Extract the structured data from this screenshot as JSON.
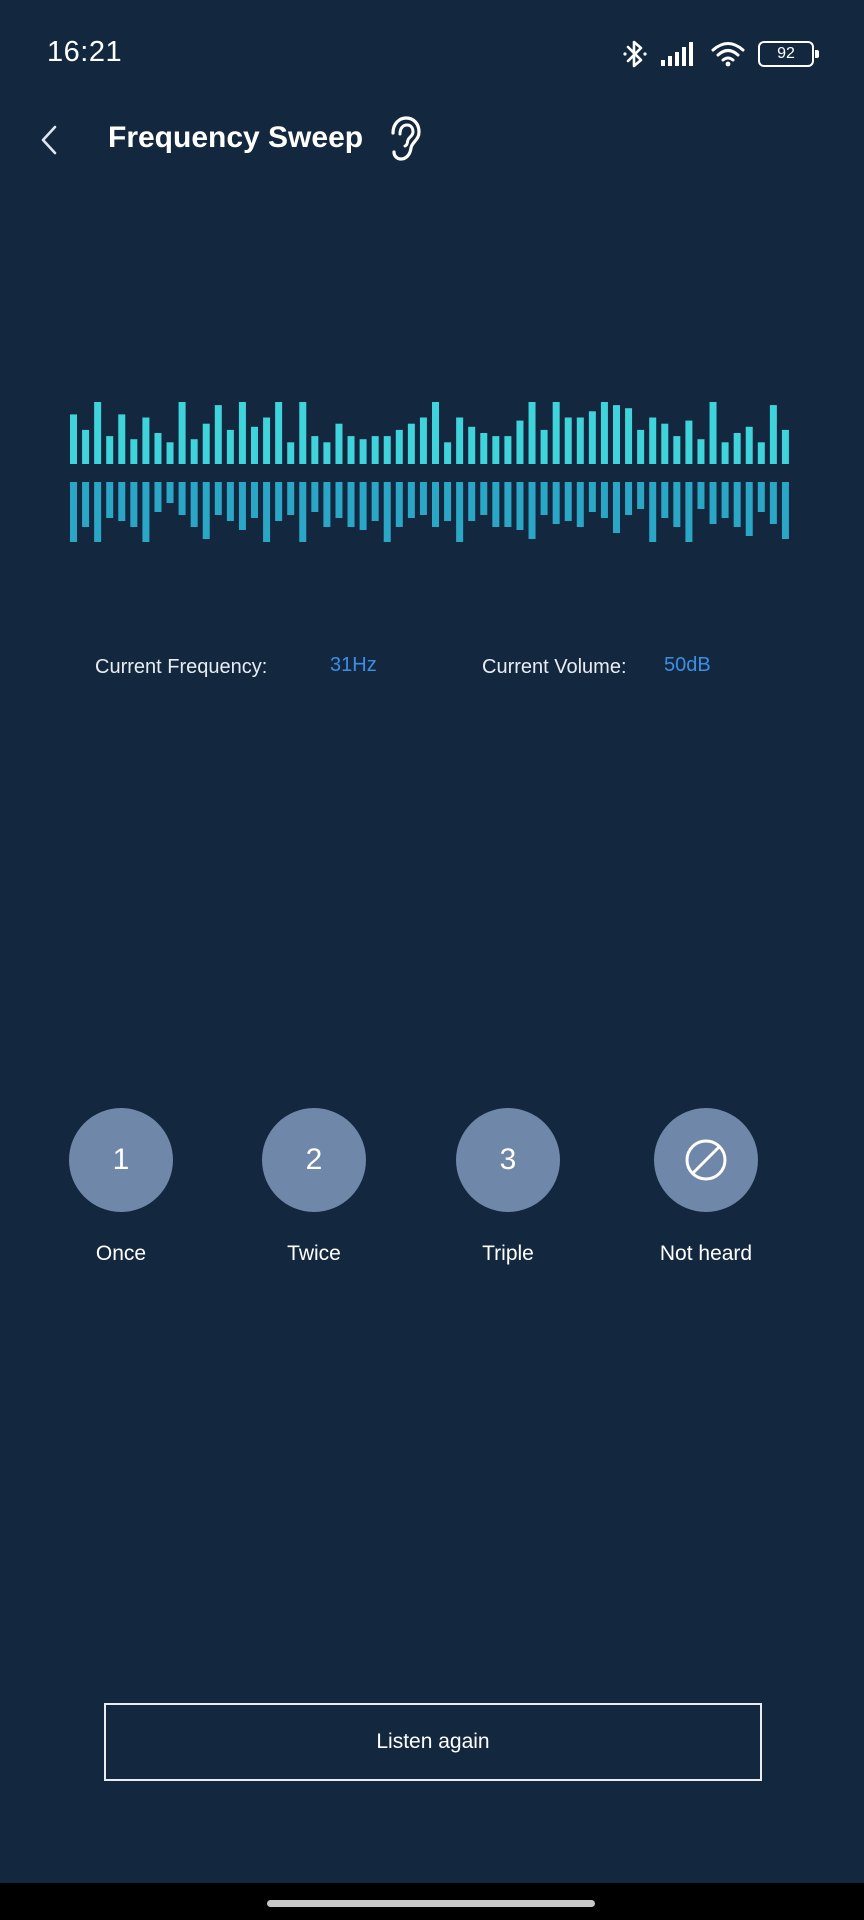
{
  "status_bar": {
    "time": "16:21",
    "battery_level": "92",
    "icons": [
      "bluetooth-icon",
      "signal-icon",
      "wifi-icon",
      "battery-icon"
    ]
  },
  "header": {
    "title": "Frequency Sweep",
    "back_icon": "chevron-left-icon",
    "title_icon": "ear-icon"
  },
  "waveform": {
    "color_top": "#3fd3dc",
    "color_bottom": "#2aa6c6",
    "upper_levels": [
      0.8,
      0.55,
      1.0,
      0.45,
      0.8,
      0.4,
      0.75,
      0.5,
      0.35,
      1.0,
      0.4,
      0.65,
      0.95,
      0.55,
      1.0,
      0.6,
      0.75,
      1.0,
      0.35,
      1.0,
      0.45,
      0.35,
      0.65,
      0.45,
      0.4,
      0.45,
      0.45,
      0.55,
      0.65,
      0.75,
      1.0,
      0.35,
      0.75,
      0.6,
      0.5,
      0.45,
      0.45,
      0.7,
      1.0,
      0.55,
      1.0,
      0.75,
      0.75,
      0.85,
      1.0,
      0.95,
      0.9,
      0.55,
      0.75,
      0.65,
      0.45,
      0.7,
      0.4,
      1.0,
      0.35,
      0.5,
      0.6,
      0.35,
      0.95,
      0.55
    ],
    "lower_levels": [
      1.0,
      0.75,
      1.0,
      0.6,
      0.65,
      0.75,
      1.0,
      0.5,
      0.35,
      0.55,
      0.75,
      0.95,
      0.55,
      0.65,
      0.8,
      0.6,
      1.0,
      0.65,
      0.55,
      1.0,
      0.5,
      0.75,
      0.6,
      0.75,
      0.8,
      0.65,
      1.0,
      0.75,
      0.6,
      0.55,
      0.75,
      0.65,
      1.0,
      0.65,
      0.55,
      0.75,
      0.75,
      0.8,
      0.95,
      0.55,
      0.7,
      0.65,
      0.75,
      0.5,
      0.6,
      0.85,
      0.55,
      0.45,
      1.0,
      0.6,
      0.75,
      1.0,
      0.45,
      0.7,
      0.6,
      0.75,
      0.9,
      0.5,
      0.7,
      0.95
    ]
  },
  "readings": {
    "frequency_label": "Current Frequency:",
    "frequency_value": "31Hz",
    "volume_label": "Current Volume:",
    "volume_value": "50dB"
  },
  "answers": [
    {
      "symbol": "1",
      "label": "Once"
    },
    {
      "symbol": "2",
      "label": "Twice"
    },
    {
      "symbol": "3",
      "label": "Triple"
    },
    {
      "symbol": "",
      "label": "Not heard",
      "icon": "prohibited-icon"
    }
  ],
  "footer": {
    "listen_again_label": "Listen again"
  }
}
